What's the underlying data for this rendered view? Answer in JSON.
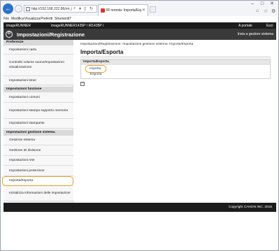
{
  "browser": {
    "url": "http://192.168.222.86/rm_impor...",
    "tab_title": "IR remota: Importa/Esporta...",
    "menu": [
      "File",
      "Modifica",
      "Visualizza",
      "Preferiti",
      "Strumenti",
      "?"
    ],
    "window_controls": [
      "–",
      "□",
      "✕"
    ]
  },
  "rui": {
    "brand": "imageRUNNER",
    "model": "imageRUNNER1435P / iR1435P /",
    "portal_link": "A portale",
    "logout": "Esci",
    "header_title": "Impostazioni/Registrazione",
    "admin_link": "Invia a gestore sistema"
  },
  "sidebar": {
    "sections": [
      {
        "title": "Preferenze",
        "items": [
          "Impostazioni carta",
          "Controllo volume suono/Impostazioni visualizzazione",
          "Impostazioni timer"
        ]
      },
      {
        "title": "Impostazioni funzione",
        "items": [
          "Impostazioni comuni",
          "Impostazioni stampa supporto memoria",
          "Impostazioni stampante"
        ]
      },
      {
        "title": "Impostazioni gestione sistema",
        "items": [
          "Gestione sistema",
          "Gestione ID divisione",
          "Impostazioni rete",
          "Impostazioni protezione",
          "Importa/Esporta",
          "Inizializza informazioni delle impostazioni"
        ]
      }
    ],
    "selected": "Importa/Esporta"
  },
  "main": {
    "breadcrumb": "Impostazioni/Registrazione: Impostazioni gestione sistema: Importa/Esporta",
    "title": "Importa/Esporta",
    "box_title": "Importa/Esporta",
    "links": [
      "Importa",
      "Esporta"
    ]
  },
  "footer": {
    "copyright": "Copyright CANON INC. 2015"
  }
}
